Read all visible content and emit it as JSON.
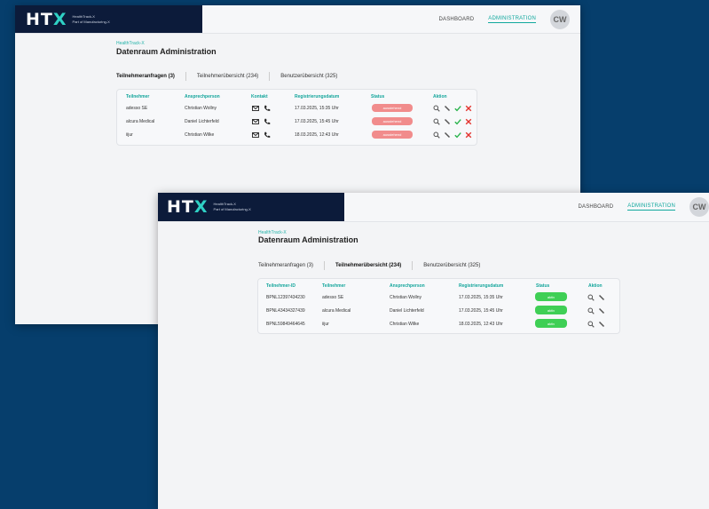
{
  "app": {
    "logo_text": "HT",
    "logo_accent": "X",
    "logo_sub_line1": "HealthTrack-X",
    "logo_sub_line2": "Part of Manufacturing-X",
    "nav": [
      "DASHBOARD",
      "ADMINISTRATION"
    ],
    "avatar_initials": "CW"
  },
  "page": {
    "breadcrumb": "HealthTrack-X",
    "title": "Datenraum Administration"
  },
  "window1": {
    "tabs": [
      "Teilnehmeranfragen (3)",
      "Teilnehmerübersicht (234)",
      "Benutzerübersicht (325)"
    ],
    "active_tab": 0,
    "columns": [
      "Teilnehmer",
      "Ansprechperson",
      "Kontakt",
      "Registrierungsdatum",
      "Status",
      "Aktion"
    ],
    "rows": [
      {
        "teilnehmer": "adesso SE",
        "ansprechperson": "Christian Wollny",
        "datum": "17.03.2025, 15:35 Uhr",
        "status": "ausstehend"
      },
      {
        "teilnehmer": "alcura Medical",
        "ansprechperson": "Daniel Lichterfeld",
        "datum": "17.03.2025, 15:45 Uhr",
        "status": "ausstehend"
      },
      {
        "teilnehmer": "iijur",
        "ansprechperson": "Christian Wilke",
        "datum": "18.03.2025, 12:43 Uhr",
        "status": "ausstehend"
      }
    ]
  },
  "window2": {
    "tabs": [
      "Teilnehmeranfragen (3)",
      "Teilnehmerübersicht (234)",
      "Benutzerübersicht (325)"
    ],
    "active_tab": 1,
    "columns": [
      "Teilnehmer-ID",
      "Teilnehmer",
      "Ansprechperson",
      "Registrierungsdatum",
      "Status",
      "Aktion"
    ],
    "rows": [
      {
        "id": "BPNL12397434230",
        "teilnehmer": "adesso SE",
        "ansprechperson": "Christian Wollny",
        "datum": "17.03.2025, 15:35 Uhr",
        "status": "aktiv"
      },
      {
        "id": "BPNL43434327439",
        "teilnehmer": "alcura Medical",
        "ansprechperson": "Daniel Lichterfeld",
        "datum": "17.03.2025, 15:45 Uhr",
        "status": "aktiv"
      },
      {
        "id": "BPNL59849464645",
        "teilnehmer": "iijur",
        "ansprechperson": "Christian Wilke",
        "datum": "18.03.2025, 12:43 Uhr",
        "status": "aktiv"
      }
    ]
  },
  "colors": {
    "background": "#063e6c",
    "header_dark": "#0c1b3a",
    "accent": "#12a89e",
    "pending": "#f18c8c",
    "active": "#3fcf55"
  }
}
